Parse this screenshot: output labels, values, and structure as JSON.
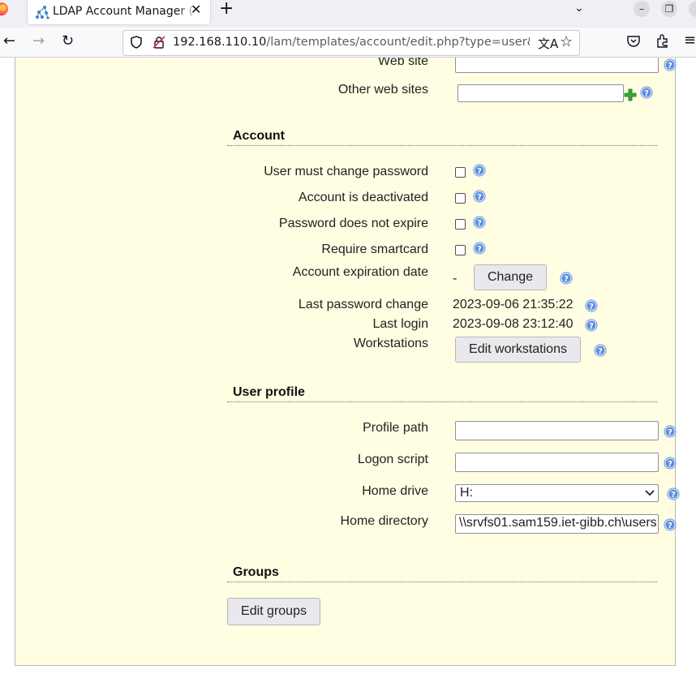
{
  "browser": {
    "tab_title": "LDAP Account Manager (",
    "tab_close": "✕",
    "new_tab": "+",
    "url_host": "192.168.110.10",
    "url_path": "/lam/templates/account/edit.php?type=user&DN"
  },
  "contact": {
    "website_label": "Web site",
    "other_websites_label": "Other web sites"
  },
  "account": {
    "section_title": "Account",
    "must_change_label": "User must change password",
    "deactivated_label": "Account is deactivated",
    "no_expire_label": "Password does not expire",
    "smartcard_label": "Require smartcard",
    "expiration_label": "Account expiration date",
    "expiration_value": "-",
    "change_button": "Change",
    "last_pw_label": "Last password change",
    "last_pw_value": "2023-09-06 21:35:22",
    "last_login_label": "Last login",
    "last_login_value": "2023-09-08 23:12:40",
    "workstations_label": "Workstations",
    "edit_workstations_button": "Edit workstations"
  },
  "profile": {
    "section_title": "User profile",
    "profile_path_label": "Profile path",
    "logon_script_label": "Logon script",
    "home_drive_label": "Home drive",
    "home_drive_value": "H:",
    "home_dir_label": "Home directory",
    "home_dir_value": "\\\\srvfs01.sam159.iet-gibb.ch\\users"
  },
  "groups": {
    "section_title": "Groups",
    "edit_groups_button": "Edit groups"
  },
  "colors": {
    "panel_bg": "#fffde2",
    "help_icon": "#5b8ddf",
    "add_icon": "#3aa53a"
  }
}
